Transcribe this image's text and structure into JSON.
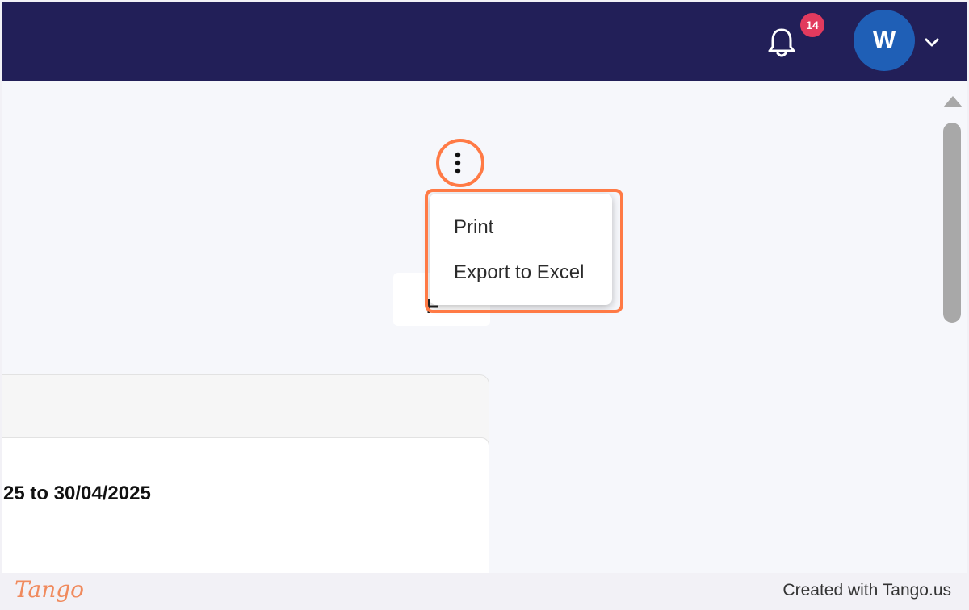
{
  "header": {
    "notification_count": "14",
    "avatar_initial": "W"
  },
  "menu": {
    "items": [
      {
        "label": "Print"
      },
      {
        "label": "Export to Excel"
      }
    ]
  },
  "content": {
    "date_range_text": "25 to 30/04/2025"
  },
  "footer": {
    "logo": "Tango",
    "credit": "Created with Tango.us"
  },
  "colors": {
    "topbar": "#221f58",
    "highlight": "#ff7a45",
    "badge": "#e23a5e",
    "avatar": "#1f5fb6"
  },
  "icons": [
    "bell-icon",
    "chevron-down-icon",
    "kebab-menu-icon",
    "scroll-up-arrow-icon"
  ]
}
